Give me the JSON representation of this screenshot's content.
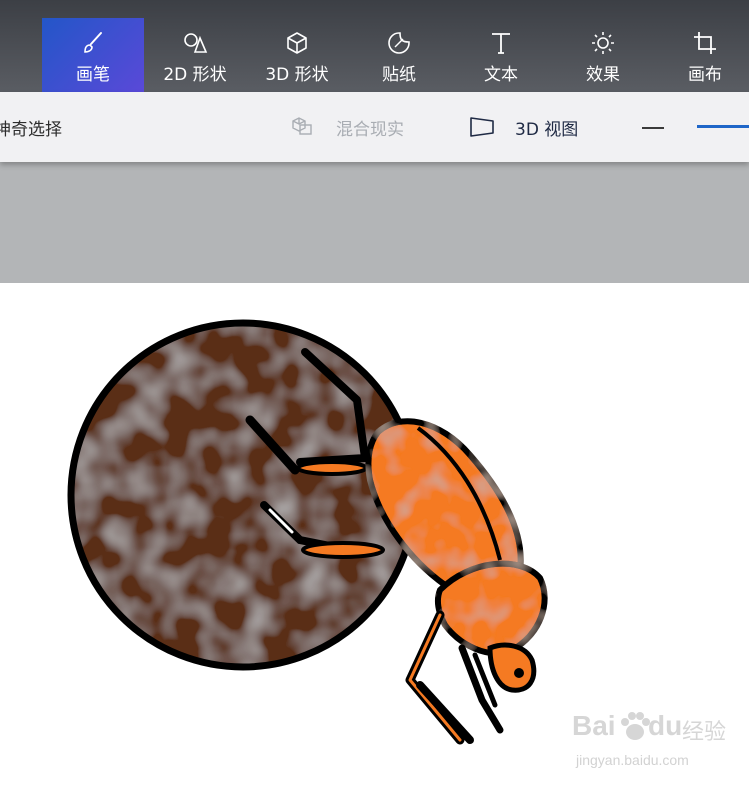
{
  "toolbar": {
    "tools": [
      {
        "label": "画笔",
        "icon": "brush-icon",
        "active": true
      },
      {
        "label": "2D 形状",
        "icon": "shapes-2d-icon"
      },
      {
        "label": "3D 形状",
        "icon": "cube-3d-icon"
      },
      {
        "label": "贴纸",
        "icon": "sticker-icon"
      },
      {
        "label": "文本",
        "icon": "text-t-icon"
      },
      {
        "label": "效果",
        "icon": "sun-effects-icon"
      },
      {
        "label": "画布",
        "icon": "canvas-crop-icon"
      }
    ],
    "active_color_start": "#2356c8",
    "active_color_end": "#5a49d8"
  },
  "subbar": {
    "magic_select": "神奇选择",
    "mixed_reality": "混合现实",
    "view_3d": "3D 视图"
  },
  "canvas": {
    "image": "dung-beetle-pushing-ball-drawing",
    "ball_color": "#5a2f14",
    "beetle_color": "#f57a22"
  },
  "watermark": {
    "brand_latin": "Bai",
    "brand_paw": "paw-icon",
    "brand_du": "du",
    "brand_cn": "经验",
    "url": "jingyan.baidu.com"
  }
}
